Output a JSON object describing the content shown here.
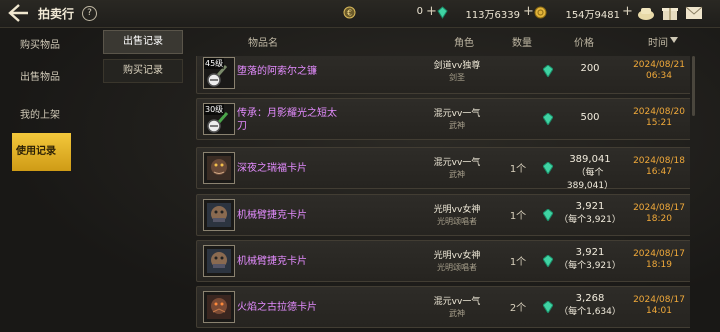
{
  "header": {
    "title": "拍卖行",
    "help": "?"
  },
  "currencies": [
    {
      "icon": "coin-icon",
      "value": "0"
    },
    {
      "icon": "gem-icon",
      "value": "113万6339"
    },
    {
      "icon": "gold-coin-icon",
      "value": "154万9481"
    }
  ],
  "nav": {
    "items": [
      {
        "label": "购买物品"
      },
      {
        "label": "出售物品"
      },
      {
        "label": "我的上架"
      },
      {
        "label": "使用记录"
      }
    ]
  },
  "subtabs": [
    {
      "label": "出售记录"
    },
    {
      "label": "购买记录"
    }
  ],
  "columns": {
    "name": "物品名",
    "role": "角色",
    "qty": "数量",
    "price": "价格",
    "time": "时间"
  },
  "rows": [
    {
      "level": "45级",
      "name": "堕落的阿索尔之镰",
      "name2": "",
      "role": "剑道vv独尊",
      "class": "剑圣",
      "qty": "",
      "price": "200",
      "each": "",
      "date": "2024/08/21",
      "clock": "06:34"
    },
    {
      "level": "30级",
      "name": "传承：月影耀光之短太",
      "name2": "刀",
      "role": "混元vv一气",
      "class": "武神",
      "qty": "",
      "price": "500",
      "each": "",
      "date": "2024/08/20",
      "clock": "15:21"
    },
    {
      "level": "",
      "name": "深夜之瑞福卡片",
      "name2": "",
      "role": "混元vv一气",
      "class": "武神",
      "qty": "1个",
      "price": "389,041",
      "each": "（每个389,041）",
      "date": "2024/08/18",
      "clock": "16:47"
    },
    {
      "level": "",
      "name": "机械臂捷克卡片",
      "name2": "",
      "role": "光明vv女神",
      "class": "光明颂唱者",
      "qty": "1个",
      "price": "3,921",
      "each": "（每个3,921）",
      "date": "2024/08/17",
      "clock": "18:20"
    },
    {
      "level": "",
      "name": "机械臂捷克卡片",
      "name2": "",
      "role": "光明vv女神",
      "class": "光明颂唱者",
      "qty": "1个",
      "price": "3,921",
      "each": "（每个3,921）",
      "date": "2024/08/17",
      "clock": "18:19"
    },
    {
      "level": "",
      "name": "火焰之古拉德卡片",
      "name2": "",
      "role": "混元vv一气",
      "class": "武神",
      "qty": "2个",
      "price": "3,268",
      "each": "（每个1,634）",
      "date": "2024/08/17",
      "clock": "14:01"
    }
  ]
}
